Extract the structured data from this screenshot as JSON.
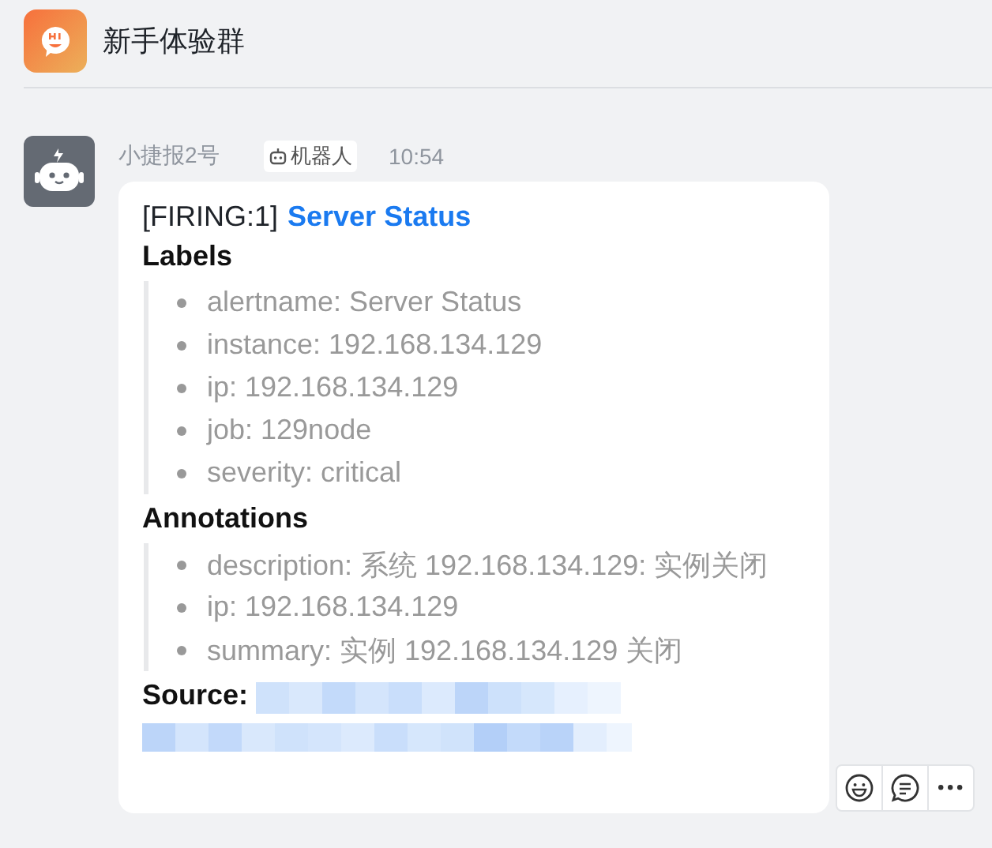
{
  "header": {
    "title": "新手体验群"
  },
  "message": {
    "sender": "小捷报2号",
    "badge": "机器人",
    "time": "10:54",
    "alert": {
      "prefix": "[FIRING:1]",
      "title": "Server Status"
    },
    "sections": [
      {
        "heading": "Labels",
        "items": [
          "alertname: Server Status",
          "instance: 192.168.134.129",
          "ip: 192.168.134.129",
          "job: 129node",
          "severity: critical"
        ]
      },
      {
        "heading": "Annotations",
        "items": [
          "description: 系统 192.168.134.129: 实例关闭",
          "ip: 192.168.134.129",
          "summary: 实例 192.168.134.129 关闭"
        ]
      }
    ],
    "source": {
      "label": "Source:",
      "redacted": true
    }
  },
  "actions": [
    {
      "kind": "emoji"
    },
    {
      "kind": "reply"
    },
    {
      "kind": "more"
    }
  ]
}
